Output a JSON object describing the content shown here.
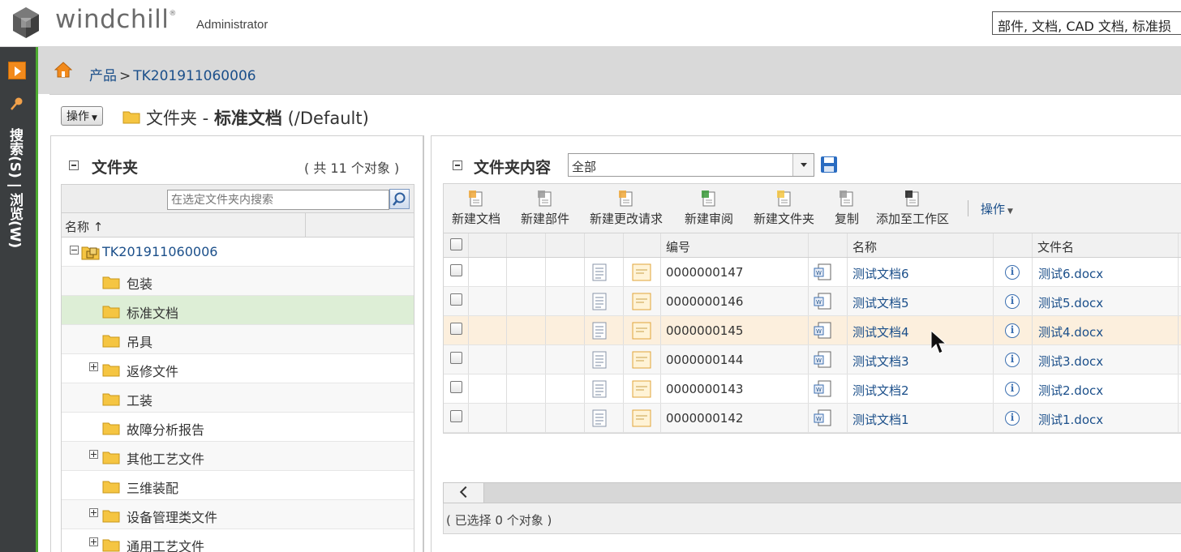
{
  "header": {
    "logo_text": "windchill",
    "logo_mark": "®",
    "user": "Administrator",
    "search_value": "部件, 文档, CAD 文档, 标准损"
  },
  "left_nav": {
    "vertical_label": "搜索(S) | 浏览(W)"
  },
  "breadcrumb": {
    "items": [
      "产品",
      "TK201911060006"
    ],
    "separator": ">"
  },
  "page": {
    "actions_label": "操作",
    "title_prefix": "文件夹 - ",
    "title_bold": "标准文档",
    "title_suffix": " (/Default)"
  },
  "folder_panel": {
    "title": "文件夹",
    "count": "( 共 11 个对象 )",
    "search_placeholder": "在选定文件夹内搜索",
    "column_name": "名称 ↑",
    "tree": [
      {
        "label": "TK201911060006",
        "level": 0,
        "expander": "minus",
        "root": true
      },
      {
        "label": "包装",
        "level": 1,
        "expander": null
      },
      {
        "label": "标准文档",
        "level": 1,
        "expander": null,
        "selected": true
      },
      {
        "label": "吊具",
        "level": 1,
        "expander": null
      },
      {
        "label": "返修文件",
        "level": 1,
        "expander": "plus"
      },
      {
        "label": "工装",
        "level": 1,
        "expander": null
      },
      {
        "label": "故障分析报告",
        "level": 1,
        "expander": null
      },
      {
        "label": "其他工艺文件",
        "level": 1,
        "expander": "plus"
      },
      {
        "label": "三维装配",
        "level": 1,
        "expander": null
      },
      {
        "label": "设备管理类文件",
        "level": 1,
        "expander": "plus"
      },
      {
        "label": "通用工艺文件",
        "level": 1,
        "expander": "plus"
      }
    ]
  },
  "content_panel": {
    "title": "文件夹内容",
    "view_value": "全部",
    "toolbar": [
      {
        "label": "新建文档",
        "icon": "new-document-icon"
      },
      {
        "label": "新建部件",
        "icon": "new-part-icon"
      },
      {
        "label": "新建更改请求",
        "icon": "new-change-request-icon"
      },
      {
        "label": "新建审阅",
        "icon": "new-review-icon"
      },
      {
        "label": "新建文件夹",
        "icon": "new-folder-icon"
      },
      {
        "label": "复制",
        "icon": "copy-icon"
      },
      {
        "label": "添加至工作区",
        "icon": "add-to-workspace-icon"
      }
    ],
    "toolbar_actions": "操作",
    "columns": {
      "number": "编号",
      "name": "名称",
      "filename": "文件名"
    },
    "rows": [
      {
        "number": "0000000147",
        "name": "测试文档6",
        "filename": "测试6.docx"
      },
      {
        "number": "0000000146",
        "name": "测试文档5",
        "filename": "测试5.docx"
      },
      {
        "number": "0000000145",
        "name": "测试文档4",
        "filename": "测试4.docx"
      },
      {
        "number": "0000000144",
        "name": "测试文档3",
        "filename": "测试3.docx"
      },
      {
        "number": "0000000143",
        "name": "测试文档2",
        "filename": "测试2.docx"
      },
      {
        "number": "0000000142",
        "name": "测试文档1",
        "filename": "测试1.docx"
      }
    ],
    "status": "( 已选择 0 个对象 )"
  },
  "colors": {
    "link": "#1b4f8a",
    "nav_dark": "#3b3e40",
    "nav_accent": "#4caa2f",
    "selected_row": "#ddeed6",
    "hover_row": "#fcefdd"
  }
}
